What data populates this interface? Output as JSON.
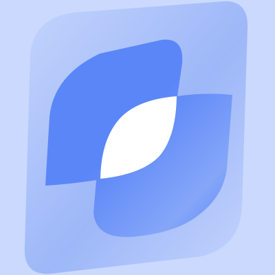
{
  "logo": {
    "icon": "leaf-swirl-logo-icon",
    "colors": {
      "page_background": "#cbd9ff",
      "outer_light": "#c4d4fc",
      "outer_mid": "#9db7f8",
      "inner_primary": "#5b86f7",
      "inner_light": "#85a6f8",
      "cutout": "#ffffff"
    }
  }
}
